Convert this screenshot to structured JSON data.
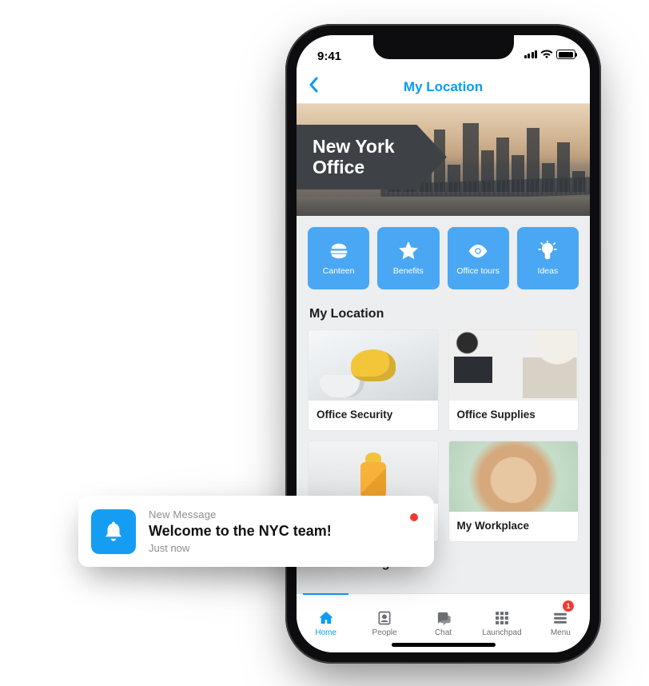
{
  "statusbar": {
    "time": "9:41"
  },
  "nav": {
    "title": "My Location"
  },
  "hero": {
    "title_line1": "New York",
    "title_line2": "Office"
  },
  "quick": [
    {
      "label": "Canteen",
      "icon": "burger-icon"
    },
    {
      "label": "Benefits",
      "icon": "star-icon"
    },
    {
      "label": "Office tours",
      "icon": "eye-icon"
    },
    {
      "label": "Ideas",
      "icon": "lightbulb-icon"
    }
  ],
  "sections": {
    "my_location": {
      "title": "My Location",
      "cards": [
        {
          "label": "Office Security"
        },
        {
          "label": "Office Supplies"
        },
        {
          "label": ""
        },
        {
          "label": "My Workplace"
        }
      ]
    },
    "office_manager": {
      "title": "Office Manager"
    }
  },
  "tabs": [
    {
      "label": "Home",
      "icon": "home-icon",
      "active": true
    },
    {
      "label": "People",
      "icon": "people-icon"
    },
    {
      "label": "Chat",
      "icon": "chat-icon"
    },
    {
      "label": "Launchpad",
      "icon": "grid-icon"
    },
    {
      "label": "Menu",
      "icon": "menu-icon",
      "badge": "1"
    }
  ],
  "notification": {
    "category": "New Message",
    "title": "Welcome to the NYC team!",
    "time": "Just now"
  }
}
